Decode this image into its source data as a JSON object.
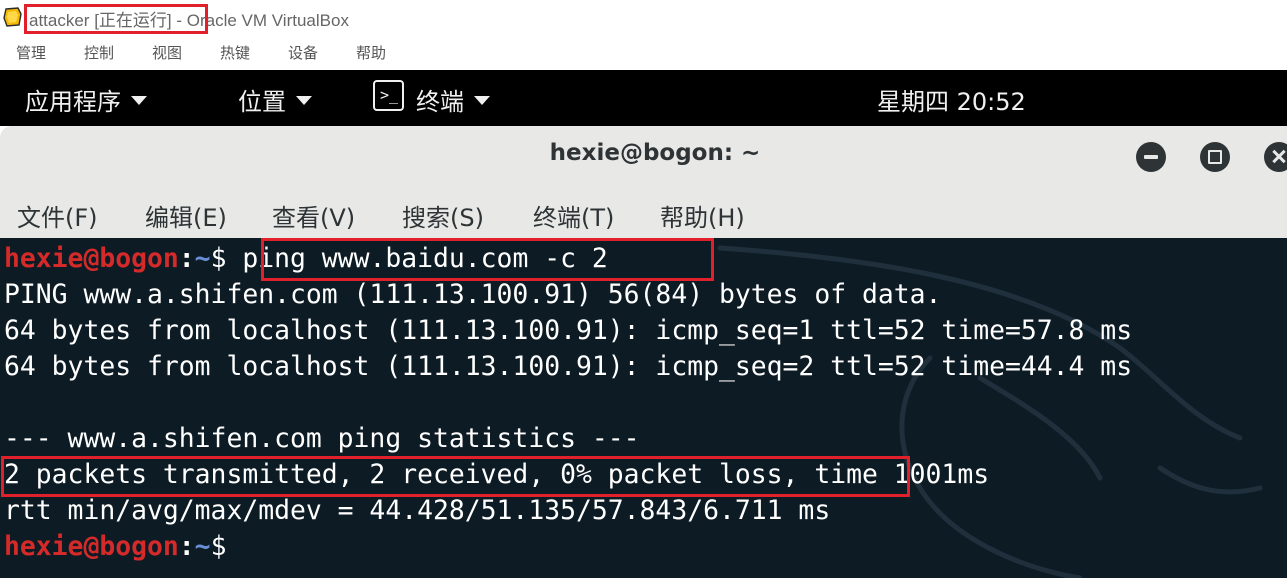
{
  "vbox": {
    "title_highlight": "attacker [正在运行] -",
    "title_rest": " Oracle VM VirtualBox",
    "icon": "virtualbox-icon",
    "menu": [
      "管理",
      "控制",
      "视图",
      "热键",
      "设备",
      "帮助"
    ]
  },
  "panel": {
    "applications": "应用程序",
    "places": "位置",
    "terminal": "终端",
    "terminal_icon": "terminal-icon",
    "clock": "星期四 20:52"
  },
  "terminal": {
    "title": "hexie@bogon: ~",
    "menu": [
      "文件(F)",
      "编辑(E)",
      "查看(V)",
      "搜索(S)",
      "终端(T)",
      "帮助(H)"
    ],
    "prompt_user": "hexie@bogon",
    "prompt_sep": ":",
    "prompt_path": "~",
    "prompt_suffix": "$ ",
    "command": "ping www.baidu.com -c 2",
    "output": [
      "PING www.a.shifen.com (111.13.100.91) 56(84) bytes of data.",
      "64 bytes from localhost (111.13.100.91): icmp_seq=1 ttl=52 time=57.8 ms",
      "64 bytes from localhost (111.13.100.91): icmp_seq=2 ttl=52 time=44.4 ms",
      "",
      "--- www.a.shifen.com ping statistics ---"
    ],
    "stats_highlight": "2 packets transmitted, 2 received, 0% packet loss,",
    "stats_rest": " time 1001ms",
    "rtt": "rtt min/avg/max/mdev = 44.428/51.135/57.843/6.711 ms",
    "final_prompt_suffix": "$",
    "colors": {
      "background": "#0d1b24",
      "prompt_user": "#d42a2a",
      "prompt_path": "#6b8fd6",
      "highlight_box": "#e0202a"
    }
  }
}
